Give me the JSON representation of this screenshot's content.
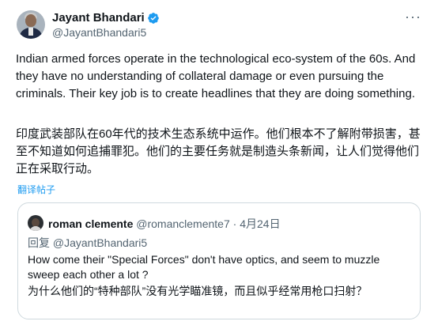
{
  "tweet": {
    "author": {
      "display_name": "Jayant Bhandari",
      "handle": "@JayantBhandari5",
      "verified": true
    },
    "more_icon": "more-horizontal-icon",
    "text": "Indian armed forces operate in the technological eco-system of the 60s. And they have no understanding of collateral damage or even pursuing the criminals. Their key job is to create headlines that they are doing something.",
    "text_translated": "印度武装部队在60年代的技术生态系统中运作。他们根本不了解附带损害，甚至不知道如何追捕罪犯。他们的主要任务就是制造头条新闻，让人们觉得他们正在采取行动。",
    "translate_label": "翻译帖子"
  },
  "quoted": {
    "display_name": "roman clemente",
    "handle": "@romanclemente7",
    "separator": "·",
    "date": "4月24日",
    "reply_to": "回复 @JayantBhandari5",
    "text": "How come their \"Special Forces\" don't have optics, and seem to muzzle sweep each other a lot ?",
    "text_translated": "为什么他们的“特种部队”没有光学瞄准镜，而且似乎经常用枪口扫射？"
  },
  "colors": {
    "text_primary": "#0f1419",
    "text_secondary": "#536471",
    "link": "#1d9bf0",
    "border": "#cfd9de",
    "verified_badge": "#1d9bf0"
  }
}
